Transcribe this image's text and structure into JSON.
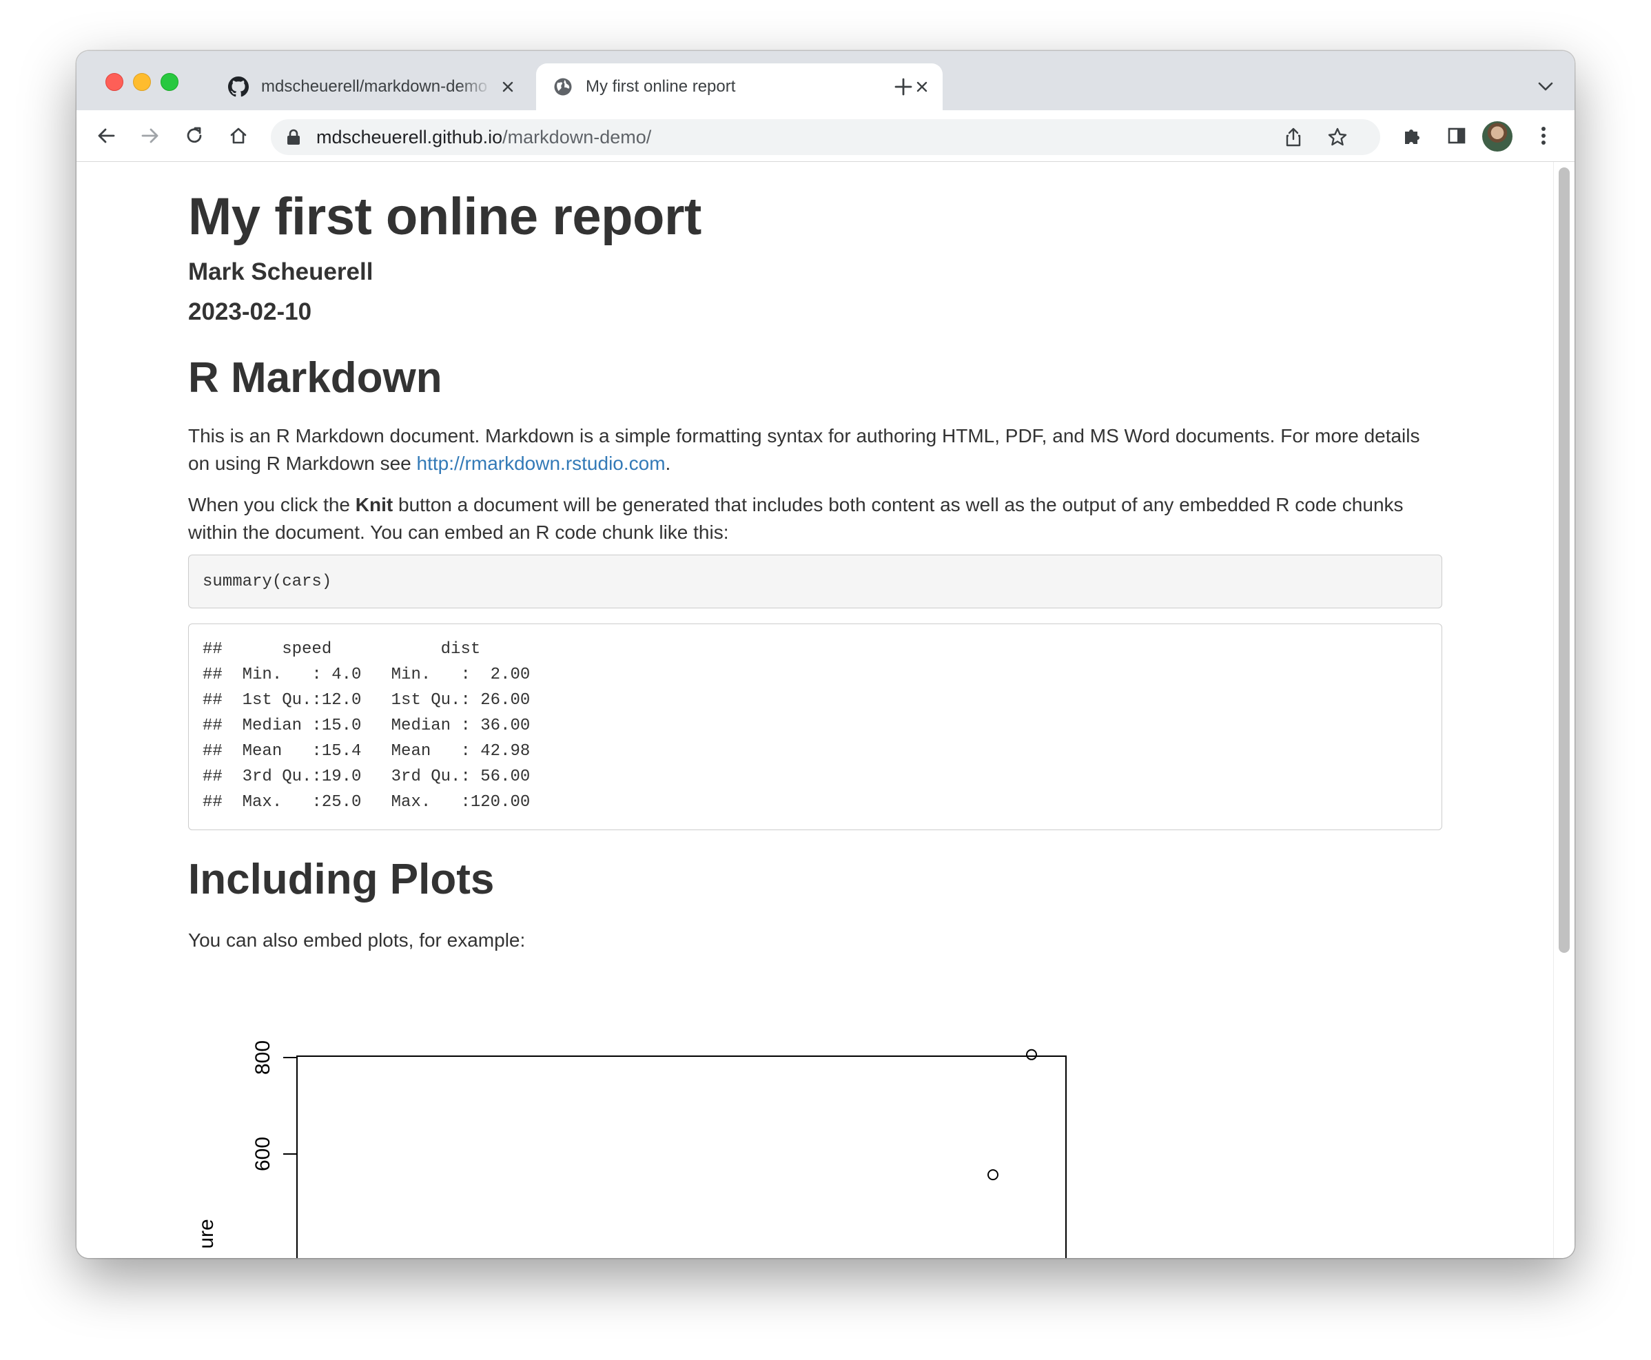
{
  "browser": {
    "tabs": [
      {
        "title": "mdscheuerell/markdown-demo",
        "icon": "github-icon",
        "active": false
      },
      {
        "title": "My first online report",
        "icon": "globe-icon",
        "active": true
      }
    ],
    "url_host": "mdscheuerell.github.io",
    "url_path": "/markdown-demo/"
  },
  "page": {
    "title": "My first online report",
    "author": "Mark Scheuerell",
    "date": "2023-02-10",
    "sections": {
      "rmarkdown": {
        "heading": "R Markdown",
        "para1_text": "This is an R Markdown document. Markdown is a simple formatting syntax for authoring HTML, PDF, and MS Word documents. For more details on using R Markdown see ",
        "para1_link": "http://rmarkdown.rstudio.com",
        "para1_end": ".",
        "para2_before": "When you click the ",
        "para2_bold": "Knit",
        "para2_after": " button a document will be generated that includes both content as well as the output of any embedded R code chunks within the document. You can embed an R code chunk like this:",
        "code": "summary(cars)",
        "output_lines": [
          "##      speed           dist       ",
          "##  Min.   : 4.0   Min.   :  2.00  ",
          "##  1st Qu.:12.0   1st Qu.: 26.00  ",
          "##  Median :15.0   Median : 36.00  ",
          "##  Mean   :15.4   Mean   : 42.98  ",
          "##  3rd Qu.:19.0   3rd Qu.: 56.00  ",
          "##  Max.   :25.0   Max.   :120.00  "
        ]
      },
      "plots": {
        "heading": "Including Plots",
        "para": "You can also embed plots, for example:"
      }
    }
  },
  "chart_data": {
    "type": "scatter",
    "title": "",
    "ylabel_partial": "ure",
    "yticks": [
      600,
      800
    ],
    "visible_points": [
      {
        "y": 806
      },
      {
        "y": 557
      }
    ]
  }
}
